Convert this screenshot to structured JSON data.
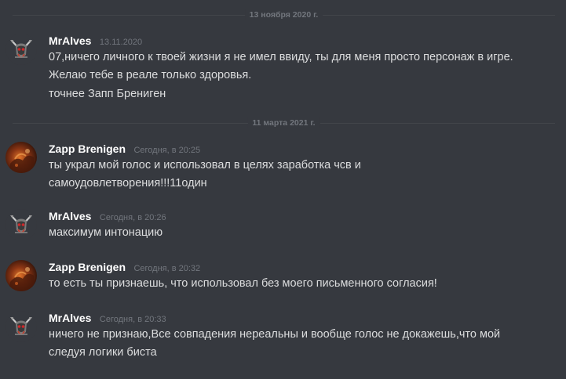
{
  "dividers": [
    "13 ноября 2020 г.",
    "11 марта 2021 г."
  ],
  "messages": [
    {
      "author": "MrAlves",
      "time": "13.11.2020",
      "avatar": "mralves-avatar",
      "lines": [
        "07,ничего личного к твоей жизни я не имел ввиду, ты для меня просто персонаж в игре. Желаю тебе в реале только здоровья.",
        "точнее Запп Брениген"
      ]
    },
    {
      "author": "Zapp Brenigen",
      "time": "Сегодня, в 20:25",
      "avatar": "zapp-avatar",
      "lines": [
        "ты украл мой голос и использовал в целях заработка чсв и самоудовлетворения!!!11один"
      ]
    },
    {
      "author": "MrAlves",
      "time": "Сегодня, в 20:26",
      "avatar": "mralves-avatar",
      "lines": [
        "максимум интонацию"
      ]
    },
    {
      "author": "Zapp Brenigen",
      "time": "Сегодня, в 20:32",
      "avatar": "zapp-avatar",
      "lines": [
        "то есть ты признаешь, что использовал без моего письменного согласия!"
      ]
    },
    {
      "author": "MrAlves",
      "time": "Сегодня, в 20:33",
      "avatar": "mralves-avatar",
      "lines": [
        "ничего не признаю,Все совпадения нереальны и вообще голос не докажешь,что мой следуя логики биста"
      ]
    }
  ]
}
